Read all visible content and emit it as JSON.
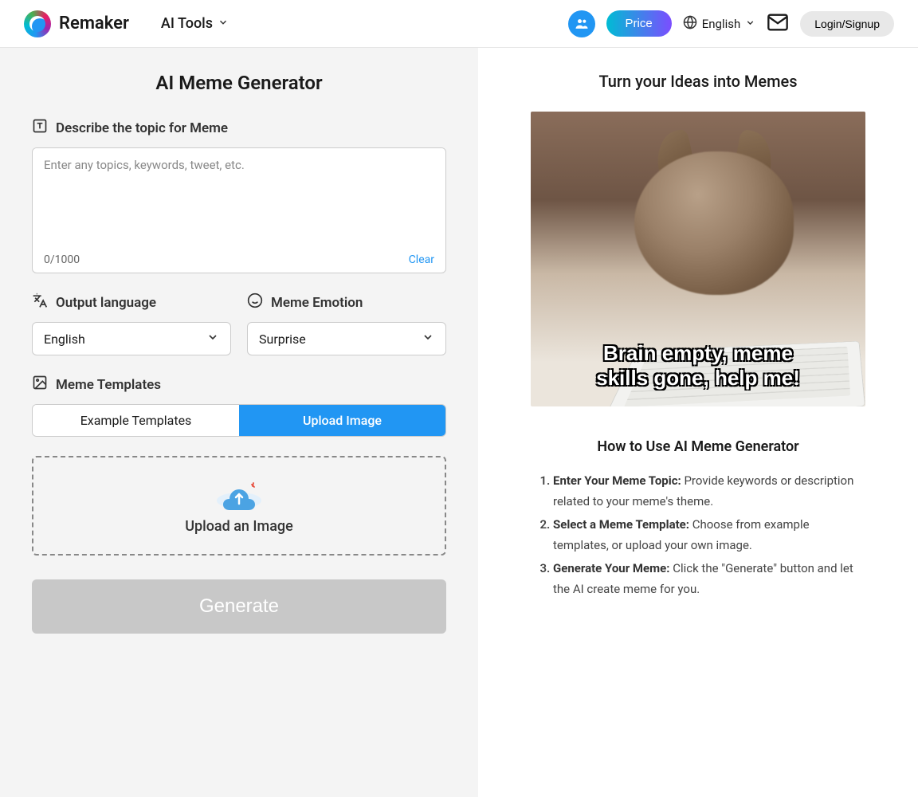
{
  "header": {
    "brand": "Remaker",
    "ai_tools": "AI Tools",
    "price": "Price",
    "language": "English",
    "login": "Login/Signup"
  },
  "left": {
    "title": "AI Meme Generator",
    "describe_label": "Describe the topic for Meme",
    "placeholder": "Enter any topics, keywords, tweet, etc.",
    "counter": "0/1000",
    "clear": "Clear",
    "lang_label": "Output language",
    "lang_value": "English",
    "emotion_label": "Meme Emotion",
    "emotion_value": "Surprise",
    "templates_label": "Meme Templates",
    "tab_example": "Example Templates",
    "tab_upload": "Upload Image",
    "upload_text": "Upload an Image",
    "generate": "Generate"
  },
  "right": {
    "hero_title": "Turn your Ideas into Memes",
    "meme_caption_line1": "Brain empty, meme",
    "meme_caption_line2": "skills gone, help me!",
    "howto_title": "How to Use AI Meme Generator",
    "steps": [
      {
        "bold": "Enter Your Meme Topic:",
        "text": " Provide keywords or description related to your meme's theme."
      },
      {
        "bold": "Select a Meme Template:",
        "text": " Choose from example templates, or upload your own image."
      },
      {
        "bold": "Generate Your Meme:",
        "text": " Click the \"Generate\" button and let the AI create meme for you."
      }
    ]
  }
}
